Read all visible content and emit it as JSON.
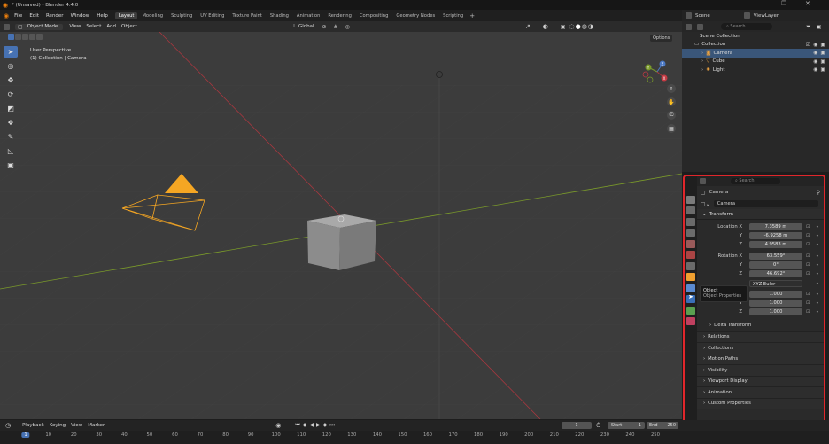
{
  "app": {
    "title": "* (Unsaved) - Blender 4.4.0"
  },
  "menu": [
    "File",
    "Edit",
    "Render",
    "Window",
    "Help"
  ],
  "workspaces": [
    "Layout",
    "Modeling",
    "Sculpting",
    "UV Editing",
    "Texture Paint",
    "Shading",
    "Animation",
    "Rendering",
    "Compositing",
    "Geometry Nodes",
    "Scripting"
  ],
  "header_right": {
    "scene": "Scene",
    "view_layer": "ViewLayer"
  },
  "viewport_header": {
    "mode": "Object Mode",
    "view": "View",
    "select": "Select",
    "add": "Add",
    "object": "Object",
    "orientation": "Global",
    "options": "Options"
  },
  "viewport": {
    "perspective": "User Perspective",
    "context": "(1) Collection | Camera",
    "gizmo_axes": [
      "X",
      "Y",
      "Z"
    ]
  },
  "outliner": {
    "search_placeholder": "Search",
    "root": "Scene Collection",
    "collection": "Collection",
    "objects": [
      {
        "name": "Camera",
        "selected": true,
        "icon": "camera-icon"
      },
      {
        "name": "Cube",
        "selected": false,
        "icon": "mesh-icon"
      },
      {
        "name": "Light",
        "selected": false,
        "icon": "light-icon"
      }
    ]
  },
  "properties": {
    "search_placeholder": "Search",
    "object_name": "Camera",
    "data_name": "Camera",
    "transform": {
      "title": "Transform",
      "location_label": "Location X",
      "location": [
        "7.3589 m",
        "-6.9258 m",
        "4.9583 m"
      ],
      "rotation_label": "Rotation X",
      "rotation": [
        "63.559°",
        "0°",
        "46.692°"
      ],
      "mode": "XYZ Euler",
      "scale": [
        "1.000",
        "1.000",
        "1.000"
      ],
      "axis_y": "Y",
      "axis_z": "Z",
      "delta": "Delta Transform"
    },
    "sections": [
      "Relations",
      "Collections",
      "Motion Paths",
      "Visibility",
      "Viewport Display",
      "Animation",
      "Custom Properties"
    ]
  },
  "tooltip": {
    "line1": "Object",
    "line2": "Object Properties"
  },
  "timeline": {
    "playback": "Playback",
    "keying": "Keying",
    "view": "View",
    "marker": "Marker",
    "current_frame": "1",
    "start_label": "Start",
    "start": "1",
    "end_label": "End",
    "end": "250",
    "ticks": [
      "1",
      "10",
      "20",
      "30",
      "40",
      "50",
      "60",
      "70",
      "80",
      "90",
      "100",
      "110",
      "120",
      "130",
      "140",
      "150",
      "160",
      "170",
      "180",
      "190",
      "200",
      "210",
      "220",
      "230",
      "240",
      "250"
    ]
  },
  "colors": {
    "accent": "#4772b3",
    "highlight_border": "#e0262b",
    "camera_orange": "#f5a623",
    "x_axis": "#a8373f",
    "y_axis": "#7a9a2a"
  }
}
